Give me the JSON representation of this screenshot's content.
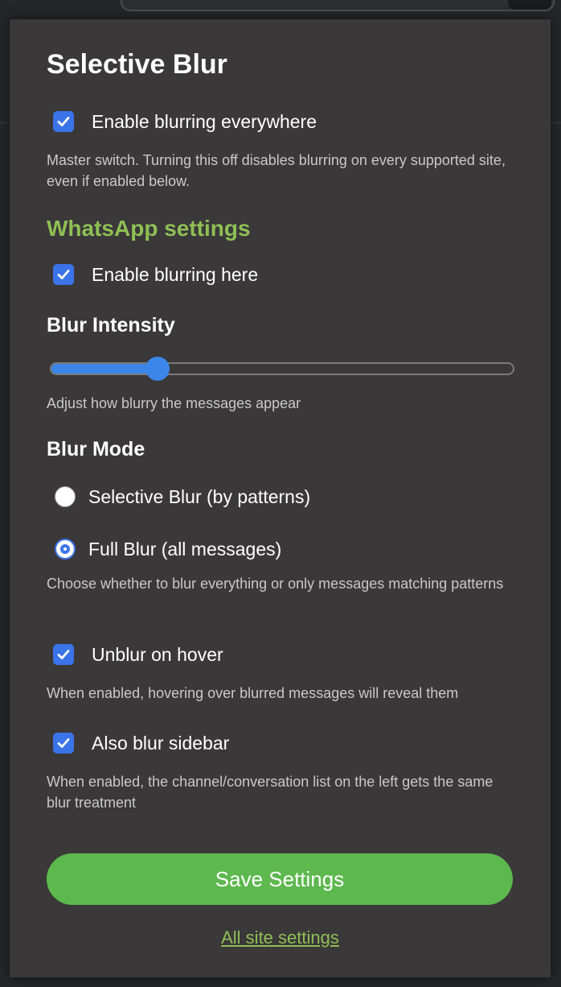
{
  "popup": {
    "title": "Selective Blur",
    "global": {
      "enable_label": "Enable blurring everywhere",
      "enabled": true,
      "description": "Master switch. Turning this off disables blurring on every supported site, even if enabled below."
    },
    "site": {
      "section_title": "WhatsApp settings",
      "enable_label": "Enable blurring here",
      "enabled": true
    },
    "intensity": {
      "heading": "Blur Intensity",
      "value_fraction": 0.23,
      "description": "Adjust how blurry the messages appear"
    },
    "mode": {
      "heading": "Blur Mode",
      "options": [
        {
          "label": "Selective Blur (by patterns)",
          "selected": false
        },
        {
          "label": "Full Blur (all messages)",
          "selected": true
        }
      ],
      "description": "Choose whether to blur everything or only messages matching patterns"
    },
    "hover": {
      "label": "Unblur on hover",
      "enabled": true,
      "description": "When enabled, hovering over blurred messages will reveal them"
    },
    "sidebar": {
      "label": "Also blur sidebar",
      "enabled": true,
      "description": "When enabled, the channel/conversation list on the left gets the same blur treatment"
    },
    "save_label": "Save Settings",
    "all_sites_link": "All site settings"
  },
  "colors": {
    "accent_blue": "#3b74e8",
    "section_green": "#8fbf55",
    "button_green": "#5db84e",
    "panel_bg": "#3a3839"
  },
  "icons": {
    "checkmark": "checkmark-icon"
  }
}
